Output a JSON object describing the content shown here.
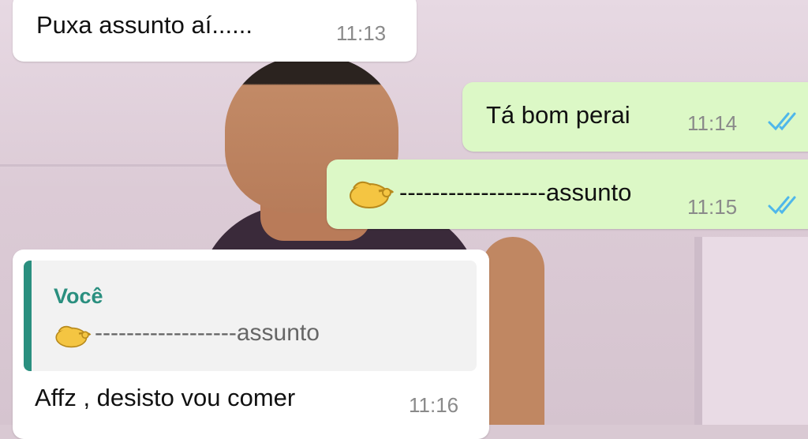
{
  "colors": {
    "incoming_bubble": "#ffffff",
    "outgoing_bubble": "#dcf8c6",
    "quote_accent": "#2a8f7f",
    "read_ticks": "#4fb7ea"
  },
  "messages": [
    {
      "direction": "incoming",
      "text": "Puxa assunto aí......",
      "time": "11:13"
    },
    {
      "direction": "outgoing",
      "text": "Tá bom perai",
      "time": "11:14",
      "status": "read"
    },
    {
      "direction": "outgoing",
      "icon": "pinch-hand-emoji",
      "text": "------------------assunto",
      "time": "11:15",
      "status": "read"
    },
    {
      "direction": "incoming",
      "quote": {
        "author": "Você",
        "icon": "pinch-hand-emoji",
        "text": "------------------assunto"
      },
      "text": "Affz , desisto vou comer",
      "time": "11:16"
    }
  ]
}
